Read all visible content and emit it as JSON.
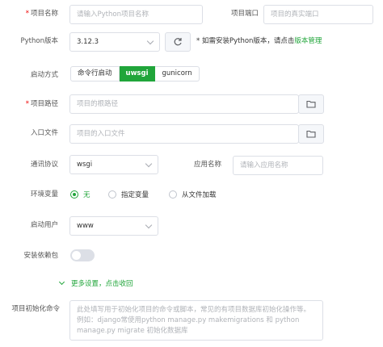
{
  "form": {
    "name": {
      "label": "项目名称",
      "required": "*",
      "placeholder": "请输入Python项目名称"
    },
    "port": {
      "label": "项目端口",
      "placeholder": "项目的真实端口"
    },
    "python_version": {
      "label": "Python版本",
      "value": "3.12.3",
      "hint_prefix": "* 如需安装Python版本，请点击",
      "hint_link": "版本管理"
    },
    "start_mode": {
      "label": "启动方式",
      "options": [
        "命令行启动",
        "uwsgi",
        "gunicorn"
      ],
      "selected": "uwsgi"
    },
    "path": {
      "label": "项目路径",
      "required": "*",
      "placeholder": "项目的根路径"
    },
    "entry": {
      "label": "入口文件",
      "placeholder": "项目的入口文件"
    },
    "protocol": {
      "label": "通讯协议",
      "value": "wsgi"
    },
    "app_name": {
      "label": "应用名称",
      "placeholder": "请输入应用名称"
    },
    "env": {
      "label": "环境变量",
      "options": [
        "无",
        "指定变量",
        "从文件加载"
      ],
      "selected": "无"
    },
    "user": {
      "label": "启动用户",
      "value": "www"
    },
    "install_deps": {
      "label": "安装依赖包",
      "enabled": false
    },
    "more_settings": {
      "label": "更多设置，点击收回"
    },
    "init_cmd": {
      "label": "项目初始化命令",
      "placeholder": "此处填写用于初始化项目的命令或脚本，常见的有项目数据库初始化操作等。例如：django常使用python manage.py makemigrations 和 python manage.py migrate 初始化数据库"
    }
  },
  "colors": {
    "accent": "#20a53a",
    "required": "#ef0000",
    "border": "#dcdfe6"
  }
}
